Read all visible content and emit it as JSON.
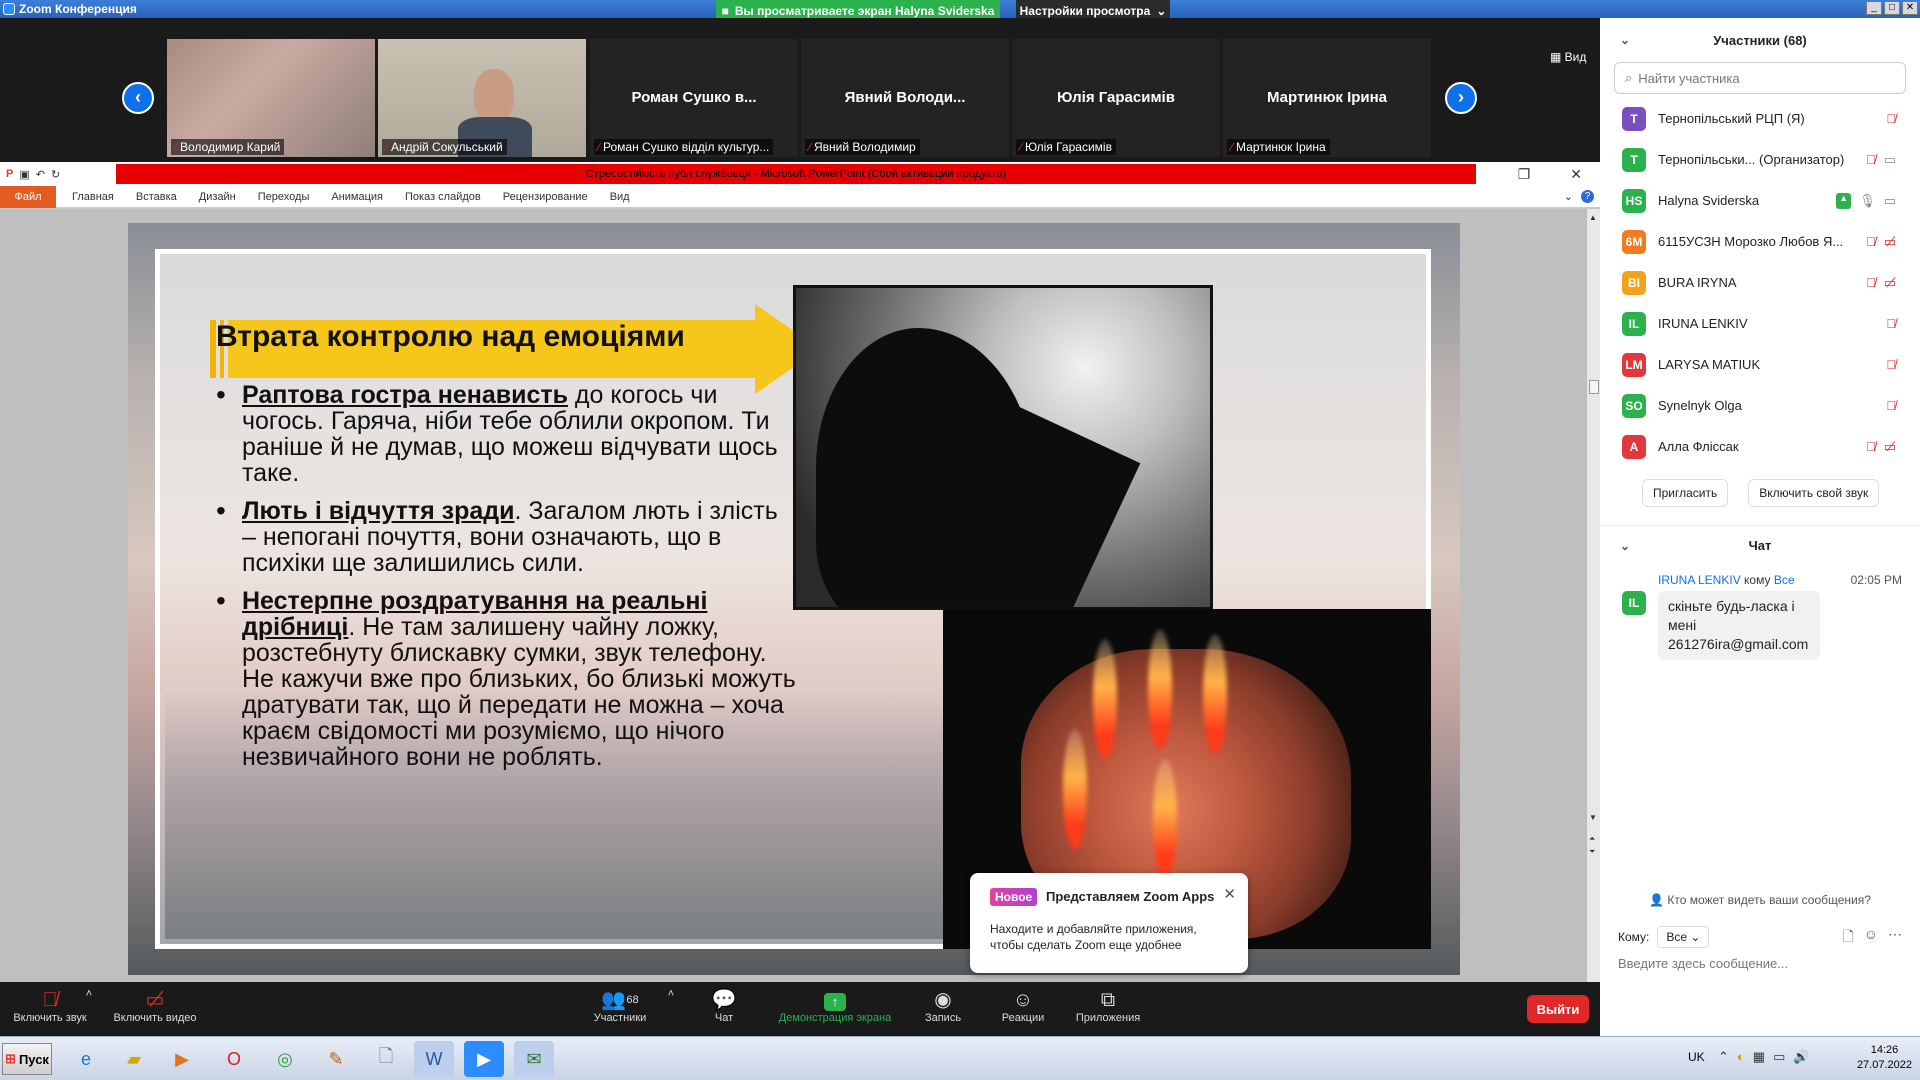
{
  "window": {
    "title": "Zoom Конференция"
  },
  "share_banner": "Вы просматриваете экран Halyna Sviderska",
  "view_options": "Настройки просмотра",
  "view_btn": "Вид",
  "video_tiles": [
    {
      "name": "",
      "label": "Володимир Карий"
    },
    {
      "name": "",
      "label": "Андрій Сокульський"
    },
    {
      "name": "Роман Сушко в...",
      "label": "Роман Сушко відділ культур..."
    },
    {
      "name": "Явний Володи...",
      "label": "Явний Володимир"
    },
    {
      "name": "Юлія Гарасимів",
      "label": "Юлія Гарасимів"
    },
    {
      "name": "Мартинюк Ірина",
      "label": "Мартинюк Ірина"
    }
  ],
  "participants": {
    "title": "Участники (68)",
    "search_placeholder": "Найти участника",
    "list": [
      {
        "initials": "T",
        "color": "#7b4fbf",
        "name": "Тернопільський РЦП (Я)"
      },
      {
        "initials": "T",
        "color": "#2bb24c",
        "name": "Тернопільськи...  (Организатор)"
      },
      {
        "initials": "HS",
        "color": "#2bb24c",
        "name": "Halyna Sviderska"
      },
      {
        "initials": "6M",
        "color": "#f47a20",
        "name": "6115УСЗН Морозко Любов Я..."
      },
      {
        "initials": "BI",
        "color": "#f2a21b",
        "name": "BURA IRYNA"
      },
      {
        "initials": "IL",
        "color": "#2bb24c",
        "name": "IRUNA LENKIV"
      },
      {
        "initials": "LM",
        "color": "#e0383e",
        "name": "LARYSA MATIUK"
      },
      {
        "initials": "SO",
        "color": "#2bb24c",
        "name": "Synelnyk Olga"
      },
      {
        "initials": "A",
        "color": "#e0383e",
        "name": "Алла Фліссак"
      }
    ],
    "invite": "Пригласить",
    "unmute_me": "Включить свой звук"
  },
  "chat": {
    "title": "Чат",
    "message": {
      "sender": "IRUNA LENKIV",
      "to_word": "кому",
      "recipient": "Все",
      "time": "02:05 PM",
      "initials": "IL",
      "text_line1": "скіньте будь-ласка і",
      "text_line2": "мені",
      "text_line3": "261276ira@gmail.com"
    },
    "who_sees": "Кто может видеть ваши сообщения?",
    "to_label": "Кому:",
    "to_value": "Все",
    "input_placeholder": "Введите здесь сообщение..."
  },
  "powerpoint": {
    "title": "Стресостійкість публ службовця - Microsoft PowerPoint (Сбой активации продукта)",
    "file_tab": "Файл",
    "tabs": [
      "Главная",
      "Вставка",
      "Дизайн",
      "Переходы",
      "Анимация",
      "Показ слайдов",
      "Рецензирование",
      "Вид"
    ]
  },
  "slide": {
    "heading": "Втрата контролю над емоціями",
    "bullets": [
      {
        "bold": "Раптова гостра ненависть",
        "rest": " до когось чи чогось. Гаряча, ніби тебе облили окропом. Ти раніше й не думав, що можеш відчувати щось таке."
      },
      {
        "bold": "Лють і відчуття зради",
        "rest": ". Загалом лють і злість – непогані почуття, вони означають, що в психіки ще залишились сили."
      },
      {
        "bold": "Нестерпне роздратування на реальні дрібниці",
        "rest": ". Не там залишену чайну ложку, розстебнуту блискавку сумки, звук телефону. Не кажучи вже про близьких, бо близькі можуть дратувати так, що й передати не можна – хоча краєм свідомості ми розуміємо, що нічого незвичайного вони не роблять."
      }
    ]
  },
  "toast": {
    "badge": "Новое",
    "title": "Представляем Zoom Apps",
    "body": "Находите и добавляйте приложения, чтобы сделать Zoom еще удобнее"
  },
  "toolbar": {
    "audio": "Включить звук",
    "video": "Включить видео",
    "participants": "Участники",
    "participants_count": "68",
    "chat": "Чат",
    "share": "Демонстрация экрана",
    "record": "Запись",
    "reactions": "Реакции",
    "apps": "Приложения",
    "leave": "Выйти"
  },
  "taskbar": {
    "start": "Пуск",
    "lang": "UK",
    "time": "14:26",
    "date": "27.07.2022"
  }
}
